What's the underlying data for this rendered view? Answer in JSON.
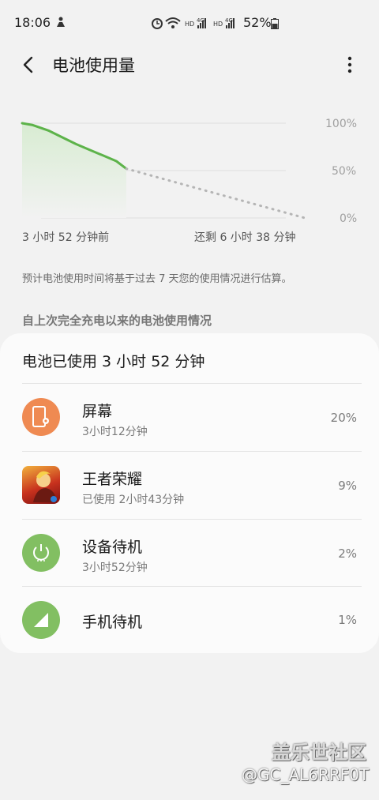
{
  "status_bar": {
    "time": "18:06",
    "battery_percent": "52%",
    "network_labels": [
      "HD",
      "4G",
      "HD",
      "4G"
    ]
  },
  "app_bar": {
    "title": "电池使用量"
  },
  "chart_data": {
    "type": "line",
    "y_ticks": [
      "100%",
      "50%",
      "0%"
    ],
    "x_start_label": "3 小时 52 分钟前",
    "x_end_label": "还剩 6 小时 38 分钟",
    "ylim": [
      0,
      100
    ],
    "grid": true,
    "series": [
      {
        "x_hours": [
          0,
          0.4,
          1.0,
          1.5,
          2.0,
          2.5,
          3.0,
          3.5,
          3.87
        ],
        "values": [
          100,
          98,
          92,
          85,
          78,
          72,
          66,
          60,
          52
        ]
      },
      {
        "x_hours": [
          3.87,
          10.5
        ],
        "values": [
          52,
          0
        ],
        "style": "dotted"
      }
    ],
    "colors": {
      "line": "#5db34a",
      "fill": "#d8ecd2",
      "projection": "#b5b5b5",
      "grid": "#dedede"
    }
  },
  "note": "预计电池使用时间将基于过去 7 天您的使用情况进行估算。",
  "section_title": "自上次完全充电以来的电池使用情况",
  "usage_card": {
    "title": "电池已使用 3 小时 52 分钟",
    "items": [
      {
        "name": "屏幕",
        "subtitle": "3小时12分钟",
        "percent": "20%",
        "icon": "screen-icon",
        "color": "#ef8a52"
      },
      {
        "name": "王者荣耀",
        "subtitle": "已使用 2小时43分钟",
        "percent": "9%",
        "icon": "game-app-icon",
        "color": "#d63a2a"
      },
      {
        "name": "设备待机",
        "subtitle": "3小时52分钟",
        "percent": "2%",
        "icon": "power-icon",
        "color": "#82bf62"
      },
      {
        "name": "手机待机",
        "subtitle": "",
        "percent": "1%",
        "icon": "signal-icon",
        "color": "#82bf62"
      }
    ]
  },
  "watermark": {
    "line1": "盖乐世社区",
    "line2": "@GC_AL6RRF0T"
  }
}
